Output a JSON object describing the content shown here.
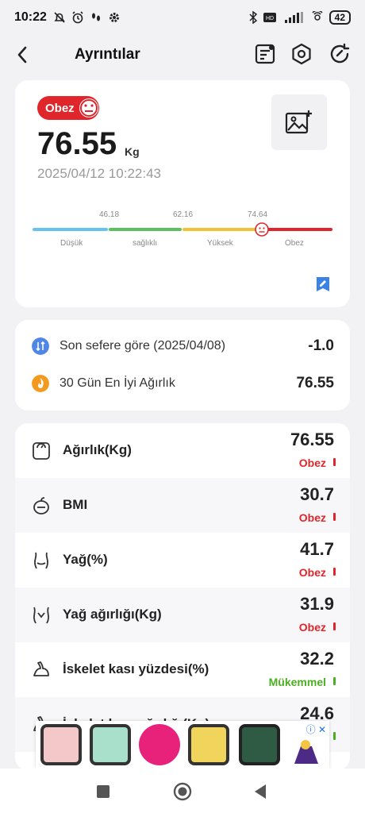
{
  "status_bar": {
    "time": "10:22",
    "battery": "42"
  },
  "header": {
    "title": "Ayrıntılar"
  },
  "summary": {
    "status_badge": "Obez",
    "weight": "76.55",
    "unit": "Kg",
    "datetime": "2025/04/12 10:22:43",
    "scale": {
      "ticks": [
        "46.18",
        "62.16",
        "74.64"
      ],
      "labels": [
        "Düşük",
        "sağlıklı",
        "Yüksek",
        "Obez"
      ],
      "colors": [
        "#66c3ef",
        "#5cc15c",
        "#f1c232",
        "#e0262b"
      ]
    }
  },
  "comparison": [
    {
      "label": "Son sefere göre (2025/04/08)",
      "value": "-1.0",
      "icon": "compare-icon"
    },
    {
      "label": "30 Gün En İyi Ağırlık",
      "value": "76.55",
      "icon": "best-weight-icon"
    }
  ],
  "metrics": [
    {
      "label": "Ağırlık(Kg)",
      "value": "76.55",
      "status": "Obez",
      "status_color": "#e0262b",
      "icon": "scale-icon"
    },
    {
      "label": "BMI",
      "value": "30.7",
      "status": "Obez",
      "status_color": "#e0262b",
      "icon": "bmi-icon"
    },
    {
      "label": "Yağ(%)",
      "value": "41.7",
      "status": "Obez",
      "status_color": "#e0262b",
      "icon": "fat-icon"
    },
    {
      "label": "Yağ ağırlığı(Kg)",
      "value": "31.9",
      "status": "Obez",
      "status_color": "#e0262b",
      "icon": "fat-weight-icon"
    },
    {
      "label": "İskelet kası yüzdesi(%)",
      "value": "32.2",
      "status": "Mükemmel",
      "status_color": "#4caf22",
      "icon": "muscle-icon"
    },
    {
      "label": "İskelet kası ağırlığı(Kg)",
      "value": "24.6",
      "status": "",
      "status_color": "#4caf22",
      "icon": "muscle-weight-icon"
    }
  ],
  "ad": {
    "info": "ⓘ ✕"
  }
}
